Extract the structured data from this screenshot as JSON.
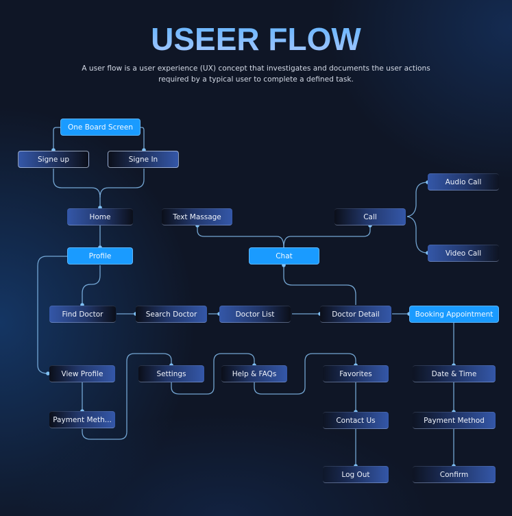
{
  "header": {
    "title": "USEER FLOW",
    "subtitle": "A user flow is a user experience (UX) concept that investigates and documents the user actions required by a typical user to complete a defined task."
  },
  "colors": {
    "background": "#0f1626",
    "accent": "#1a9bff",
    "connector": "#7fb6e6",
    "node_dark": "#0b0f1a",
    "node_blue": "#3457a8",
    "title_gradient_top": "#5fb3ff",
    "title_gradient_bottom": "#a9c8ff"
  },
  "nodes": {
    "onboard": "One Board Screen",
    "signup": "Signe up",
    "signin": "Signe In",
    "home": "Home",
    "text_message": "Text Massage",
    "call": "Call",
    "audio_call": "Audio Call",
    "video_call": "Video Call",
    "profile": "Profile",
    "chat": "Chat",
    "find_doctor": "Find Doctor",
    "search_doctor": "Search Doctor",
    "doctor_list": "Doctor List",
    "doctor_detail": "Doctor Detail",
    "booking": "Booking Appointment",
    "view_profile": "View Profile",
    "settings": "Settings",
    "help_faqs": "Help & FAQs",
    "favorites": "Favorites",
    "date_time": "Date & Time",
    "payment_short": "Payment Meth...",
    "contact_us": "Contact Us",
    "payment_method": "Payment Method",
    "log_out": "Log Out",
    "confirm": "Confirm"
  }
}
